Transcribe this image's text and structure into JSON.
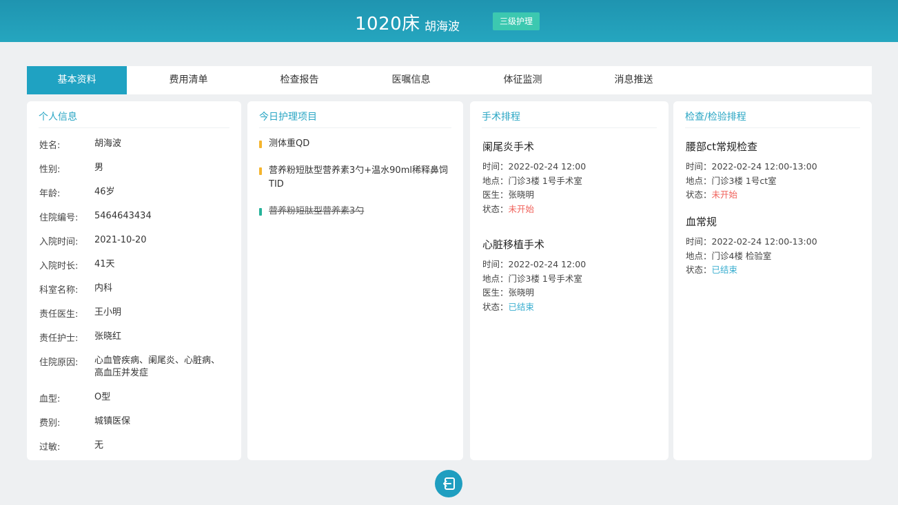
{
  "header": {
    "bed": "1020床",
    "patient_name": "胡海波",
    "care_level": "三级护理"
  },
  "tabs": [
    {
      "label": "基本资料",
      "active": true
    },
    {
      "label": "费用清单",
      "active": false
    },
    {
      "label": "检查报告",
      "active": false
    },
    {
      "label": "医嘱信息",
      "active": false
    },
    {
      "label": "体征监测",
      "active": false
    },
    {
      "label": "消息推送",
      "active": false
    }
  ],
  "personal": {
    "title": "个人信息",
    "rows": [
      {
        "label": "姓名:",
        "value": "胡海波"
      },
      {
        "label": "性别:",
        "value": "男"
      },
      {
        "label": "年龄:",
        "value": "46岁"
      },
      {
        "label": "住院编号:",
        "value": "5464643434"
      },
      {
        "label": "入院时间:",
        "value": "2021-10-20"
      },
      {
        "label": "入院时长:",
        "value": "41天"
      },
      {
        "label": "科室名称:",
        "value": "内科"
      },
      {
        "label": "责任医生:",
        "value": "王小明"
      },
      {
        "label": "责任护士:",
        "value": "张晓红"
      },
      {
        "label": "住院原因:",
        "value": "心血管疾病、阑尾炎、心脏病、高血压并发症"
      },
      {
        "label": "血型:",
        "value": "O型"
      },
      {
        "label": "费别:",
        "value": "城镇医保"
      },
      {
        "label": "过敏:",
        "value": "无"
      }
    ]
  },
  "care": {
    "title": "今日护理项目",
    "items": [
      {
        "text": "测体重QD",
        "color": "#f5b52e",
        "done": false
      },
      {
        "text": "营养粉短肽型营养素3勺+温水90ml稀释鼻饲TID",
        "color": "#f5b52e",
        "done": false
      },
      {
        "text": "营养粉短肽型营养素3勺",
        "color": "#26b39a",
        "done": true
      }
    ]
  },
  "surgery": {
    "title": "手术排程",
    "items": [
      {
        "name": "阑尾炎手术",
        "time": "时间：2022-02-24  12:00",
        "place": "地点：门诊3楼 1号手术室",
        "doctor": "医生：张晓明",
        "status_label": "状态：",
        "status": "未开始",
        "status_color": "#f0625b"
      },
      {
        "name": "心脏移植手术",
        "time": "时间：2022-02-24  12:00",
        "place": "地点：门诊3楼 1号手术室",
        "doctor": "医生：张晓明",
        "status_label": "状态：",
        "status": "已结束",
        "status_color": "#3aaed0"
      }
    ]
  },
  "exam": {
    "title": "检查/检验排程",
    "items": [
      {
        "name": "腰部ct常规检查",
        "time": "时间：2022-02-24  12:00-13:00",
        "place": "地点：门诊3楼 1号ct室",
        "status_label": "状态：",
        "status": "未开始",
        "status_color": "#f0625b"
      },
      {
        "name": "血常规",
        "time": "时间：2022-02-24  12:00-13:00",
        "place": "地点：门诊4楼 检验室",
        "status_label": "状态：",
        "status": "已结束",
        "status_color": "#3aaed0"
      }
    ]
  },
  "exit_icon": "exit-icon"
}
